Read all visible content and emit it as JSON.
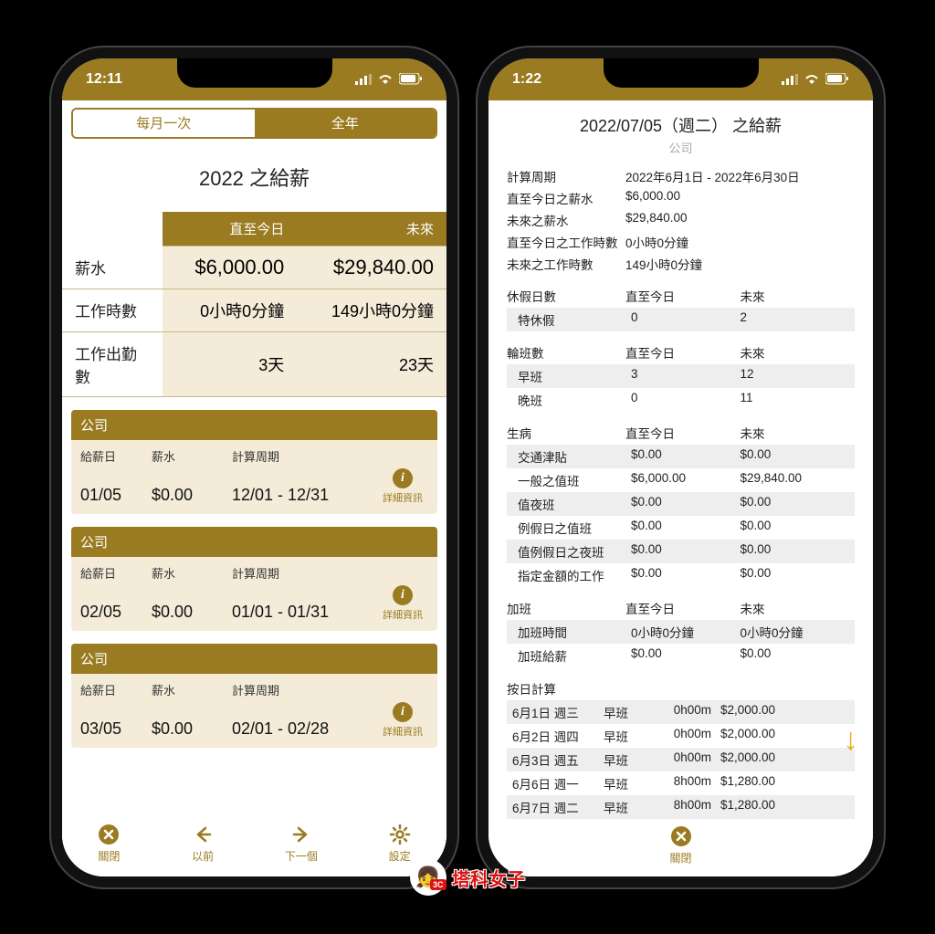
{
  "accent": "#9a7b22",
  "phone1": {
    "status_time": "12:11",
    "segmented": {
      "monthly": "每月一次",
      "yearly": "全年"
    },
    "title": "2022 之給薪",
    "summary": {
      "cols": {
        "today": "直至今日",
        "future": "未來"
      },
      "rows": {
        "salary": {
          "label": "薪水",
          "today": "$6,000.00",
          "future": "$29,840.00"
        },
        "hours": {
          "label": "工作時數",
          "today": "0小時0分鐘",
          "future": "149小時0分鐘"
        },
        "attendance": {
          "label": "工作出勤數",
          "today": "3天",
          "future": "23天"
        }
      }
    },
    "cards": [
      {
        "company": "公司",
        "payday_label": "給薪日",
        "payday": "01/05",
        "salary_label": "薪水",
        "salary": "$0.00",
        "period_label": "計算周期",
        "period": "12/01 - 12/31",
        "detail_label": "詳細資訊"
      },
      {
        "company": "公司",
        "payday_label": "給薪日",
        "payday": "02/05",
        "salary_label": "薪水",
        "salary": "$0.00",
        "period_label": "計算周期",
        "period": "01/01 - 01/31",
        "detail_label": "詳細資訊"
      },
      {
        "company": "公司",
        "payday_label": "給薪日",
        "payday": "03/05",
        "salary_label": "薪水",
        "salary": "$0.00",
        "period_label": "計算周期",
        "period": "02/01 - 02/28",
        "detail_label": "詳細資訊"
      }
    ],
    "bottombar": {
      "close": "關閉",
      "prev": "以前",
      "next": "下一個",
      "settings": "設定"
    }
  },
  "phone2": {
    "status_time": "1:22",
    "title": "2022/07/05（週二） 之給薪",
    "subtitle": "公司",
    "kv": {
      "period_label": "計算周期",
      "period": "2022年6月1日 - 2022年6月30日",
      "salary_today_label": "直至今日之薪水",
      "salary_today": "$6,000.00",
      "salary_future_label": "未來之薪水",
      "salary_future": "$29,840.00",
      "hours_today_label": "直至今日之工作時數",
      "hours_today": "0小時0分鐘",
      "hours_future_label": "未來之工作時數",
      "hours_future": "149小時0分鐘"
    },
    "cols": {
      "today": "直至今日",
      "future": "未來"
    },
    "vacation": {
      "title": "休假日數",
      "rows": [
        {
          "name": "特休假",
          "today": "0",
          "future": "2"
        }
      ]
    },
    "shifts": {
      "title": "輪班數",
      "rows": [
        {
          "name": "早班",
          "today": "3",
          "future": "12"
        },
        {
          "name": "晚班",
          "today": "0",
          "future": "11"
        }
      ]
    },
    "sick": {
      "title": "生病",
      "rows": [
        {
          "name": "交通津貼",
          "today": "$0.00",
          "future": "$0.00"
        },
        {
          "name": "一般之值班",
          "today": "$6,000.00",
          "future": "$29,840.00"
        },
        {
          "name": "值夜班",
          "today": "$0.00",
          "future": "$0.00"
        },
        {
          "name": "例假日之值班",
          "today": "$0.00",
          "future": "$0.00"
        },
        {
          "name": "值例假日之夜班",
          "today": "$0.00",
          "future": "$0.00"
        },
        {
          "name": "指定金額的工作",
          "today": "$0.00",
          "future": "$0.00"
        }
      ]
    },
    "overtime": {
      "title": "加班",
      "rows": [
        {
          "name": "加班時間",
          "today": "0小時0分鐘",
          "future": "0小時0分鐘"
        },
        {
          "name": "加班給薪",
          "today": "$0.00",
          "future": "$0.00"
        }
      ]
    },
    "daily": {
      "title": "按日計算",
      "rows": [
        {
          "date": "6月1日 週三",
          "shift": "早班",
          "dur": "0h00m",
          "amt": "$2,000.00"
        },
        {
          "date": "6月2日 週四",
          "shift": "早班",
          "dur": "0h00m",
          "amt": "$2,000.00"
        },
        {
          "date": "6月3日 週五",
          "shift": "早班",
          "dur": "0h00m",
          "amt": "$2,000.00"
        },
        {
          "date": "6月6日 週一",
          "shift": "早班",
          "dur": "8h00m",
          "amt": "$1,280.00"
        },
        {
          "date": "6月7日 週二",
          "shift": "早班",
          "dur": "8h00m",
          "amt": "$1,280.00"
        }
      ]
    },
    "close": "關閉"
  },
  "watermark": {
    "badge": "3C",
    "text": "塔科女子"
  }
}
